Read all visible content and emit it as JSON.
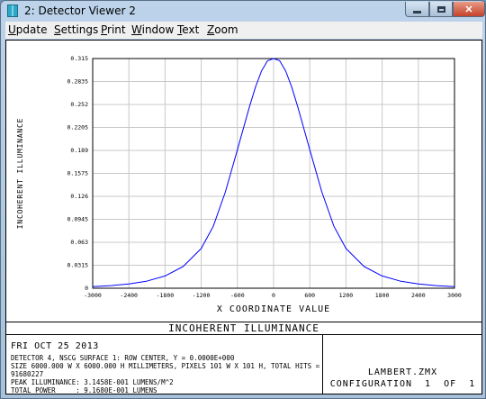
{
  "window": {
    "title": "2: Detector Viewer 2"
  },
  "menu": [
    {
      "mnemonic": "U",
      "rest": "pdate"
    },
    {
      "mnemonic": "S",
      "rest": "ettings"
    },
    {
      "mnemonic": "P",
      "rest": "rint"
    },
    {
      "mnemonic": "W",
      "rest": "indow"
    },
    {
      "mnemonic": "T",
      "rest": "ext"
    },
    {
      "mnemonic": "Z",
      "rest": "oom"
    }
  ],
  "chart_data": {
    "type": "line",
    "xlabel": "X COORDINATE VALUE",
    "ylabel": "INCOHERENT ILLUMINANCE",
    "xlim": [
      -3000,
      3000
    ],
    "ylim": [
      0,
      0.315
    ],
    "x_ticks": [
      "-3000",
      "-2400",
      "-1800",
      "-1200",
      "-600",
      "0",
      "600",
      "1200",
      "1800",
      "2400",
      "3000"
    ],
    "y_ticks": [
      "0",
      "0.0315",
      "0.063",
      "0.0945",
      "0.126",
      "0.1575",
      "0.189",
      "0.2205",
      "0.252",
      "0.2835",
      "0.315"
    ],
    "series": [
      {
        "color": "#0000ff",
        "x": [
          -3000,
          -2700,
          -2400,
          -2100,
          -1800,
          -1500,
          -1200,
          -1000,
          -800,
          -600,
          -400,
          -300,
          -200,
          -100,
          0,
          100,
          200,
          300,
          400,
          600,
          800,
          1000,
          1200,
          1500,
          1800,
          2100,
          2400,
          2700,
          3000
        ],
        "y": [
          0.0021,
          0.0035,
          0.0058,
          0.0098,
          0.0168,
          0.0298,
          0.0545,
          0.085,
          0.132,
          0.19,
          0.249,
          0.276,
          0.298,
          0.312,
          0.315,
          0.312,
          0.298,
          0.276,
          0.249,
          0.19,
          0.132,
          0.085,
          0.0545,
          0.0298,
          0.0168,
          0.0098,
          0.0058,
          0.0035,
          0.0021
        ]
      }
    ]
  },
  "footer": {
    "title": "INCOHERENT ILLUMINANCE",
    "date": "FRI OCT 25 2013",
    "line1": "DETECTOR 4, NSCG SURFACE 1: ROW CENTER, Y = 0.0000E+000",
    "line2": "SIZE 6000.000 W X 6000.000 H MILLIMETERS, PIXELS 101 W X 101 H, TOTAL HITS = 91680227",
    "line3": "PEAK ILLUMINANCE: 3.1458E-001 LUMENS/M^2",
    "line4": "TOTAL POWER     : 9.1680E-001 LUMENS",
    "file": "LAMBERT.ZMX",
    "config": "CONFIGURATION  1  OF  1"
  }
}
